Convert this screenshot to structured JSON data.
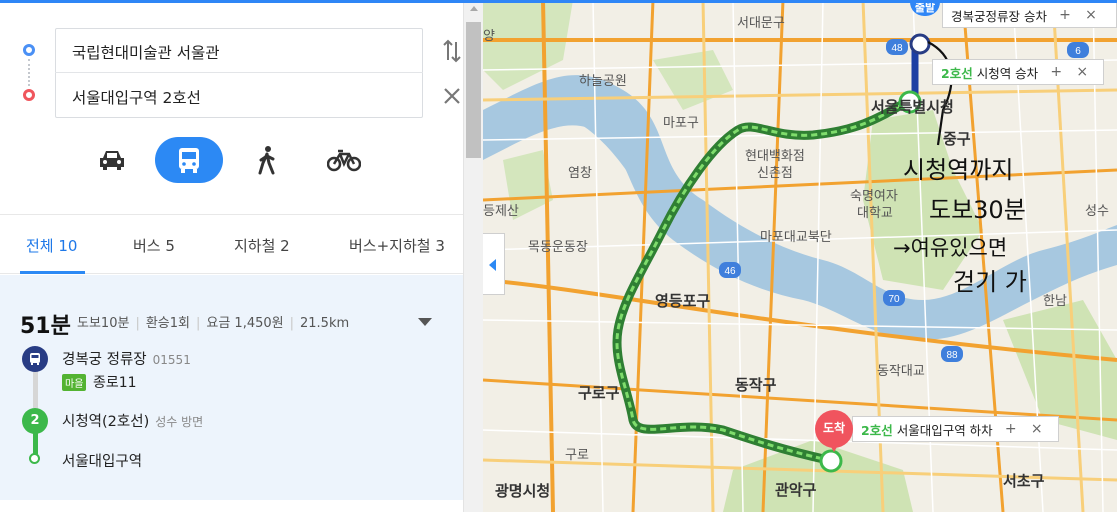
{
  "route": {
    "start": "국립현대미술관 서울관",
    "end": "서울대입구역 2호선"
  },
  "modes": [
    "car",
    "bus",
    "walk",
    "bike"
  ],
  "tabs": [
    {
      "label": "전체 10"
    },
    {
      "label": "버스 5"
    },
    {
      "label": "지하철 2"
    },
    {
      "label": "버스+지하철 3"
    }
  ],
  "result": {
    "duration": "51분",
    "walk": "도보10분",
    "transfer": "환승1회",
    "fare": "요금 1,450원",
    "distance": "21.5km",
    "steps": [
      {
        "name": "경복궁 정류장",
        "sub": "01551",
        "badge": "마을",
        "route": "종로11"
      },
      {
        "name": "시청역(2호선)",
        "sub": "성수 방면"
      },
      {
        "name": "서울대입구역"
      }
    ]
  },
  "map": {
    "callouts": [
      {
        "text": "경복궁정류장 승차"
      },
      {
        "line": "2호선",
        "text": "시청역 승차"
      },
      {
        "line": "2호선",
        "text": "서울대입구역 하차"
      }
    ],
    "markers": {
      "start": "출발",
      "arrive": "도착"
    },
    "labels": [
      "서대문구",
      "하늘공원",
      "마포구",
      "현대백화점",
      "신촌점",
      "염창",
      "숙명여자",
      "대학교",
      "마포대교북단",
      "목동운동장",
      "영등포구",
      "구로구",
      "구로",
      "동작구",
      "동작대교",
      "관악구",
      "광명시청",
      "서초구",
      "성수",
      "한남",
      "중구",
      "서울특별시청",
      "등제산",
      "양"
    ],
    "highway_numbers": [
      "48",
      "46",
      "70",
      "88",
      "6"
    ],
    "handwriting": [
      "시청역까지",
      "도보30분",
      "→여유있으면",
      "걷기 가"
    ],
    "colors": {
      "route": "#3cb84a",
      "accent": "#2c89f4",
      "water": "#a7c8e0",
      "arterial": "#f2a230"
    }
  }
}
